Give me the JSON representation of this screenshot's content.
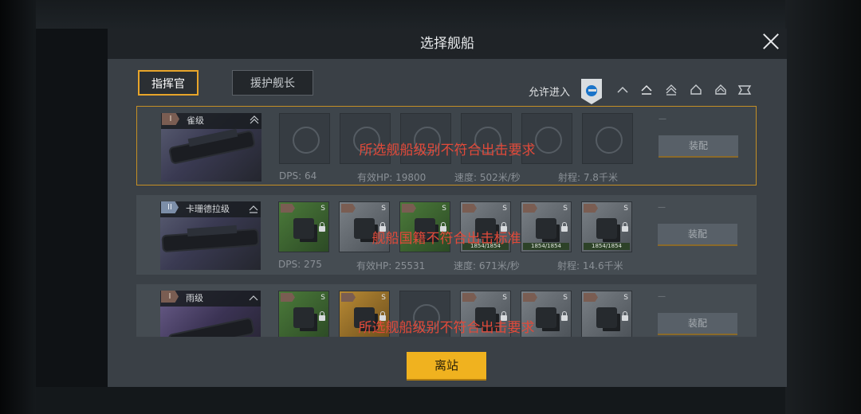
{
  "dialog": {
    "title": "选择舰船",
    "tabs": [
      {
        "label": "指挥官",
        "active": true
      },
      {
        "label": "援护舰长",
        "active": false
      }
    ],
    "filter": {
      "label": "允许进入",
      "icons": [
        "frigate-icon",
        "destroyer-icon",
        "cruiser-icon",
        "battlecruiser-icon",
        "carrier-icon",
        "battleship-icon",
        "flagship-icon"
      ]
    },
    "leave_button": "离站"
  },
  "ships": [
    {
      "tier": "I",
      "name": "雀级",
      "warning": "所选舰船级别不符合出击要求",
      "dps": "DPS: 64",
      "hp": "有效HP: 19800",
      "speed": "速度: 502米/秒",
      "range": "射程: 7.8千米",
      "equip_label": "装配",
      "dash": "—"
    },
    {
      "tier": "II",
      "name": "卡珊德拉级",
      "warning": "舰船国籍不符合出击标准",
      "dps": "DPS: 275",
      "hp": "有效HP: 25531",
      "speed": "速度: 671米/秒",
      "range": "射程: 14.6千米",
      "equip_label": "装配",
      "dash": "—",
      "slot_hp": "1854/1854"
    },
    {
      "tier": "I",
      "name": "雨级",
      "warning": "所选舰船级别不符合出击要求",
      "equip_label": "装配",
      "dash": "—"
    }
  ],
  "colors": {
    "accent": "#f0b21f",
    "selected_border": "#c48f25",
    "warning": "#e24a3a",
    "filter_active": "#1a74c9"
  }
}
